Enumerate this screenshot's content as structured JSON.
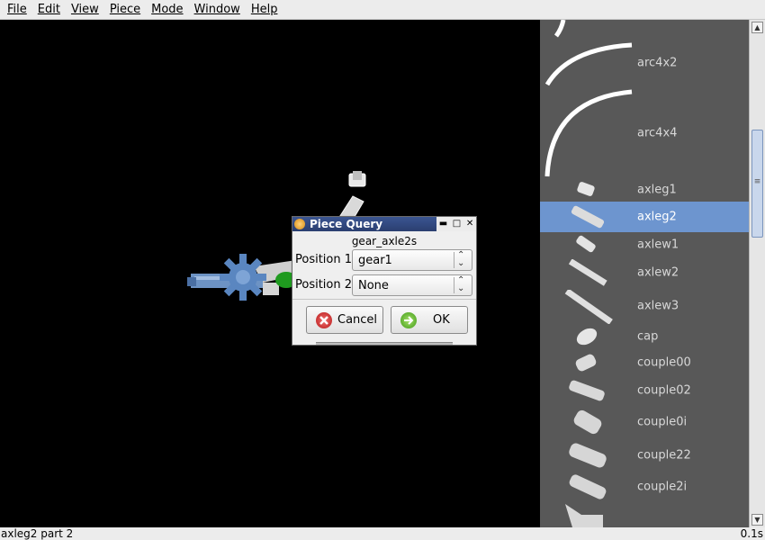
{
  "menu": [
    "File",
    "Edit",
    "View",
    "Piece",
    "Mode",
    "Window",
    "Help"
  ],
  "pieces": [
    {
      "label": "arc4x2",
      "selected": false
    },
    {
      "label": "arc4x4",
      "selected": false
    },
    {
      "label": "axleg1",
      "selected": false
    },
    {
      "label": "axleg2",
      "selected": true
    },
    {
      "label": "axlew1",
      "selected": false
    },
    {
      "label": "axlew2",
      "selected": false
    },
    {
      "label": "axlew3",
      "selected": false
    },
    {
      "label": "cap",
      "selected": false
    },
    {
      "label": "couple00",
      "selected": false
    },
    {
      "label": "couple02",
      "selected": false
    },
    {
      "label": "couple0i",
      "selected": false
    },
    {
      "label": "couple22",
      "selected": false
    },
    {
      "label": "couple2i",
      "selected": false
    }
  ],
  "dialog": {
    "title": "Piece Query",
    "piece_name": "gear_axle2s",
    "position1_label": "Position 1",
    "position1_value": "gear1",
    "position2_label": "Position 2",
    "position2_value": "None",
    "cancel_label": "Cancel",
    "ok_label": "OK",
    "min_glyph": "▬",
    "max_glyph": "□",
    "close_glyph": "✕"
  },
  "status": {
    "left": "axleg2 part 2",
    "right": "0.1s"
  },
  "colors": {
    "selection": "#6d95cf",
    "list_background": "#585858",
    "viewport_background": "#000000",
    "titlebar": "#2b3f70"
  }
}
